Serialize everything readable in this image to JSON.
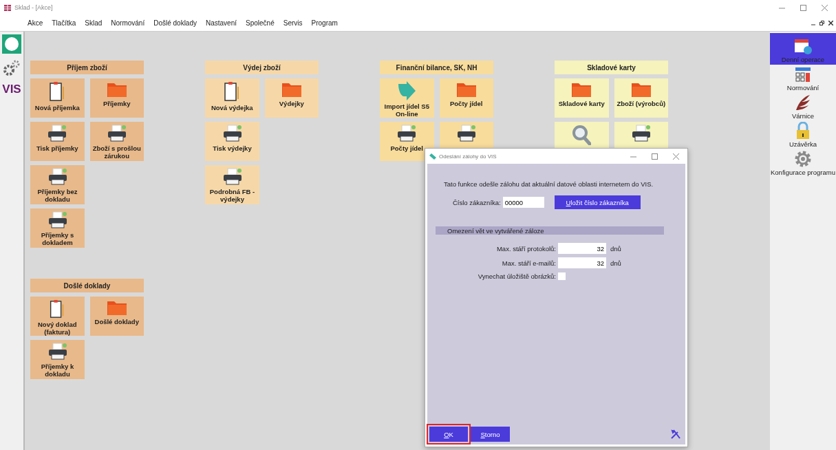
{
  "window": {
    "title": "Sklad - [Akce]"
  },
  "menu": [
    "Akce",
    "Tlačítka",
    "Sklad",
    "Normování",
    "Došlé doklady",
    "Nastavení",
    "Společné",
    "Servis",
    "Program"
  ],
  "left_toolbar": {
    "label": "VIS"
  },
  "columns": [
    {
      "groups": [
        {
          "title": "Příjem zboží",
          "color": "#e8b98a",
          "rows": [
            [
              {
                "label": "Nová příjemka",
                "kind": "form"
              },
              {
                "label": "Příjemky",
                "kind": "list"
              }
            ],
            [
              {
                "label": "Tisk příjemky",
                "kind": "print"
              },
              {
                "label": "Zboží s prošlou zárukou",
                "kind": "print"
              }
            ],
            [
              {
                "label": "Příjemky bez dokladu",
                "kind": "print"
              }
            ],
            [
              {
                "label": "Příjemky s dokladem",
                "kind": "print"
              }
            ]
          ]
        },
        {
          "title": "Došlé doklady",
          "color": "#e8b98a",
          "rows": [
            [
              {
                "label": "Nový doklad (faktura)",
                "kind": "form"
              },
              {
                "label": "Došlé doklady",
                "kind": "list"
              }
            ],
            [
              {
                "label": "Příjemky k dokladu",
                "kind": "print"
              }
            ]
          ]
        }
      ]
    },
    {
      "groups": [
        {
          "title": "Výdej zboží",
          "color": "#f6d8a8",
          "rows": [
            [
              {
                "label": "Nová výdejka",
                "kind": "form"
              },
              {
                "label": "Výdejky",
                "kind": "list"
              }
            ],
            [
              {
                "label": "Tisk výdejky",
                "kind": "print"
              }
            ],
            [
              {
                "label": "Podrobná FB - výdejky",
                "kind": "print"
              }
            ]
          ]
        }
      ]
    },
    {
      "groups": [
        {
          "title": "Finanční bilance, SK, NH",
          "color": "#f8dc9c",
          "rows": [
            [
              {
                "label": "Import jídel S5 On-line",
                "kind": "import"
              },
              {
                "label": "Počty jídel",
                "kind": "list"
              }
            ],
            [
              {
                "label": "Počty jídel",
                "kind": "print"
              },
              {
                "kind": "print"
              }
            ]
          ]
        }
      ]
    },
    {
      "groups": [
        {
          "title": "Skladové karty",
          "color": "#f6f3bc",
          "rows": [
            [
              {
                "label": "Skladové karty",
                "kind": "list"
              },
              {
                "label": "Zboží (výrobců)",
                "kind": "list"
              }
            ],
            [
              {
                "kind": "view"
              },
              {
                "kind": "print"
              }
            ]
          ]
        }
      ]
    }
  ],
  "side_panel": {
    "items": [
      {
        "label": "Denní operace",
        "kind": "calendar",
        "selected": true
      },
      {
        "label": "Normování",
        "kind": "calculator",
        "selected": false
      },
      {
        "label": "Várnice",
        "kind": "feathers",
        "selected": false
      },
      {
        "label": "Uzávěrka",
        "kind": "lock",
        "selected": false
      },
      {
        "label": "Konfigurace programu",
        "kind": "gear",
        "selected": false
      }
    ]
  },
  "dialog": {
    "title": "Odeslání zálohy do VIS",
    "intro": "Tato funkce odešle zálohu dat aktuální datové oblasti internetem do VIS.",
    "customer": {
      "label": "Číslo zákazníka:",
      "value": "00000"
    },
    "save_button": "Uložit číslo zákazníka",
    "section": "Omezení vět ve vytvářené záloze",
    "limits": [
      {
        "label": "Max. stáří protokolů:",
        "value": "32",
        "unit": "dnů"
      },
      {
        "label": "Max. stáří e-mailů:",
        "value": "32",
        "unit": "dnů"
      }
    ],
    "option": {
      "label": "Vynechat úložiště obrázků:",
      "checked": false
    },
    "buttons": [
      {
        "label": "OK",
        "highlighted": true
      },
      {
        "label": "Storno",
        "highlighted": false
      }
    ]
  }
}
